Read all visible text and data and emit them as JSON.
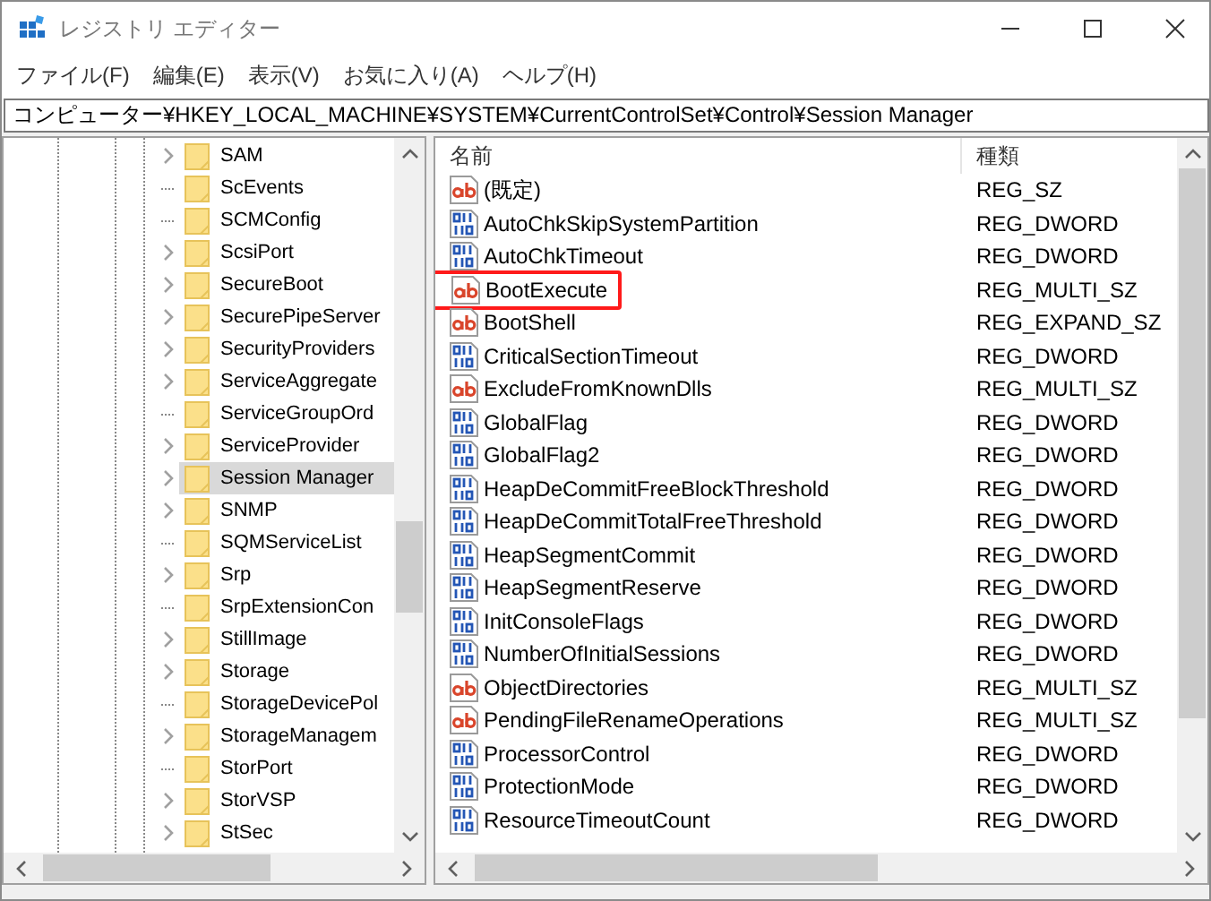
{
  "window": {
    "title": "レジストリ エディター"
  },
  "menu": [
    "ファイル(F)",
    "編集(E)",
    "表示(V)",
    "お気に入り(A)",
    "ヘルプ(H)"
  ],
  "address": "コンピューター¥HKEY_LOCAL_MACHINE¥SYSTEM¥CurrentControlSet¥Control¥Session Manager",
  "tree": [
    {
      "label": "SAM",
      "has_children": true,
      "selected": false
    },
    {
      "label": "ScEvents",
      "has_children": false,
      "selected": false
    },
    {
      "label": "SCMConfig",
      "has_children": false,
      "selected": false
    },
    {
      "label": "ScsiPort",
      "has_children": true,
      "selected": false
    },
    {
      "label": "SecureBoot",
      "has_children": true,
      "selected": false
    },
    {
      "label": "SecurePipeServer",
      "has_children": true,
      "selected": false
    },
    {
      "label": "SecurityProviders",
      "has_children": true,
      "selected": false
    },
    {
      "label": "ServiceAggregate",
      "has_children": true,
      "selected": false
    },
    {
      "label": "ServiceGroupOrd",
      "has_children": false,
      "selected": false
    },
    {
      "label": "ServiceProvider",
      "has_children": true,
      "selected": false
    },
    {
      "label": "Session Manager",
      "has_children": true,
      "selected": true
    },
    {
      "label": "SNMP",
      "has_children": true,
      "selected": false
    },
    {
      "label": "SQMServiceList",
      "has_children": false,
      "selected": false
    },
    {
      "label": "Srp",
      "has_children": true,
      "selected": false
    },
    {
      "label": "SrpExtensionCon",
      "has_children": false,
      "selected": false
    },
    {
      "label": "StillImage",
      "has_children": true,
      "selected": false
    },
    {
      "label": "Storage",
      "has_children": true,
      "selected": false
    },
    {
      "label": "StorageDevicePol",
      "has_children": false,
      "selected": false
    },
    {
      "label": "StorageManagem",
      "has_children": true,
      "selected": false
    },
    {
      "label": "StorPort",
      "has_children": false,
      "selected": false
    },
    {
      "label": "StorVSP",
      "has_children": true,
      "selected": false
    },
    {
      "label": "StSec",
      "has_children": true,
      "selected": false
    }
  ],
  "values": {
    "columns": [
      "名前",
      "種類"
    ],
    "rows": [
      {
        "kind": "string",
        "name": "(既定)",
        "type": "REG_SZ",
        "highlighted": false
      },
      {
        "kind": "binary",
        "name": "AutoChkSkipSystemPartition",
        "type": "REG_DWORD",
        "highlighted": false
      },
      {
        "kind": "binary",
        "name": "AutoChkTimeout",
        "type": "REG_DWORD",
        "highlighted": false
      },
      {
        "kind": "string",
        "name": "BootExecute",
        "type": "REG_MULTI_SZ",
        "highlighted": true
      },
      {
        "kind": "string",
        "name": "BootShell",
        "type": "REG_EXPAND_SZ",
        "highlighted": false
      },
      {
        "kind": "binary",
        "name": "CriticalSectionTimeout",
        "type": "REG_DWORD",
        "highlighted": false
      },
      {
        "kind": "string",
        "name": "ExcludeFromKnownDlls",
        "type": "REG_MULTI_SZ",
        "highlighted": false
      },
      {
        "kind": "binary",
        "name": "GlobalFlag",
        "type": "REG_DWORD",
        "highlighted": false
      },
      {
        "kind": "binary",
        "name": "GlobalFlag2",
        "type": "REG_DWORD",
        "highlighted": false
      },
      {
        "kind": "binary",
        "name": "HeapDeCommitFreeBlockThreshold",
        "type": "REG_DWORD",
        "highlighted": false
      },
      {
        "kind": "binary",
        "name": "HeapDeCommitTotalFreeThreshold",
        "type": "REG_DWORD",
        "highlighted": false
      },
      {
        "kind": "binary",
        "name": "HeapSegmentCommit",
        "type": "REG_DWORD",
        "highlighted": false
      },
      {
        "kind": "binary",
        "name": "HeapSegmentReserve",
        "type": "REG_DWORD",
        "highlighted": false
      },
      {
        "kind": "binary",
        "name": "InitConsoleFlags",
        "type": "REG_DWORD",
        "highlighted": false
      },
      {
        "kind": "binary",
        "name": "NumberOfInitialSessions",
        "type": "REG_DWORD",
        "highlighted": false
      },
      {
        "kind": "string",
        "name": "ObjectDirectories",
        "type": "REG_MULTI_SZ",
        "highlighted": false
      },
      {
        "kind": "string",
        "name": "PendingFileRenameOperations",
        "type": "REG_MULTI_SZ",
        "highlighted": false
      },
      {
        "kind": "binary",
        "name": "ProcessorControl",
        "type": "REG_DWORD",
        "highlighted": false
      },
      {
        "kind": "binary",
        "name": "ProtectionMode",
        "type": "REG_DWORD",
        "highlighted": false
      },
      {
        "kind": "binary",
        "name": "ResourceTimeoutCount",
        "type": "REG_DWORD",
        "highlighted": false
      }
    ]
  }
}
